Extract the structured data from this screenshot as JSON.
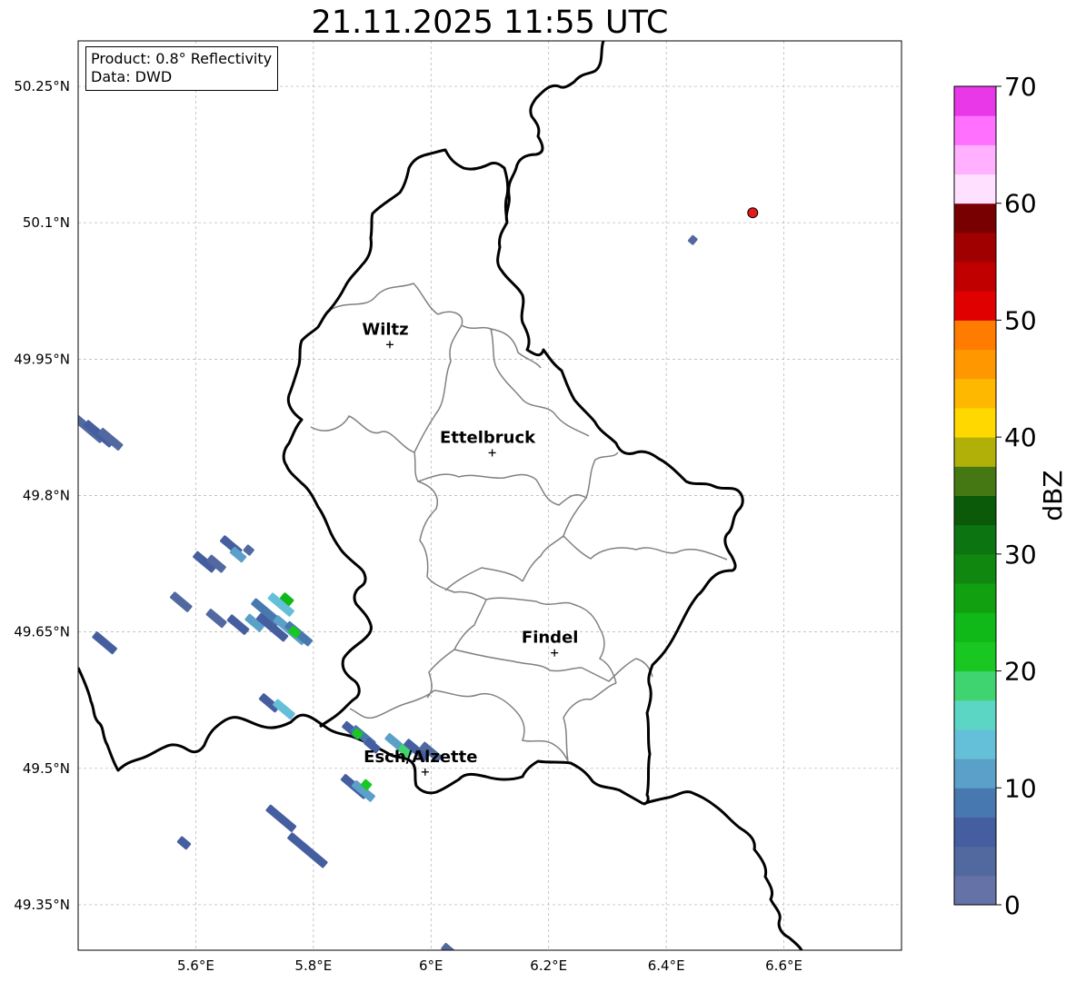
{
  "map": {
    "title": "21.11.2025 11:55 UTC",
    "info": {
      "product": "Product: 0.8° Reflectivity",
      "data": "Data: DWD"
    },
    "extent": {
      "lon": [
        5.4,
        6.8
      ],
      "lat": [
        49.3,
        50.3
      ]
    },
    "lon_ticks": [
      {
        "value": 5.6,
        "label": "5.6°E"
      },
      {
        "value": 5.8,
        "label": "5.8°E"
      },
      {
        "value": 6.0,
        "label": "6°E"
      },
      {
        "value": 6.2,
        "label": "6.2°E"
      },
      {
        "value": 6.4,
        "label": "6.4°E"
      },
      {
        "value": 6.6,
        "label": "6.6°E"
      }
    ],
    "lat_ticks": [
      {
        "value": 50.25,
        "label": "50.25°N"
      },
      {
        "value": 50.1,
        "label": "50.1°N"
      },
      {
        "value": 49.95,
        "label": "49.95°N"
      },
      {
        "value": 49.8,
        "label": "49.8°N"
      },
      {
        "value": 49.65,
        "label": "49.65°N"
      },
      {
        "value": 49.5,
        "label": "49.5°N"
      },
      {
        "value": 49.35,
        "label": "49.35°N"
      }
    ],
    "cities": [
      {
        "name": "Wiltz",
        "lon": 5.93,
        "lat": 49.966
      },
      {
        "name": "Ettelbruck",
        "lon": 6.104,
        "lat": 49.847
      },
      {
        "name": "Findel",
        "lon": 6.21,
        "lat": 49.627
      },
      {
        "name": "Esch/Alzette",
        "lon": 5.99,
        "lat": 49.496
      }
    ],
    "radar_marker": {
      "lon": 6.547,
      "lat": 50.111,
      "color": "#e31a1c"
    },
    "colorbar": {
      "label": "dBZ",
      "ticks": [
        "0",
        "10",
        "20",
        "30",
        "40",
        "50",
        "60",
        "70"
      ],
      "min": 0,
      "max": 70,
      "step": 2.5,
      "colors": [
        "#6472a8",
        "#52699f",
        "#455e9f",
        "#4878b0",
        "#5aa0c8",
        "#64c0d8",
        "#5cd6c4",
        "#40d470",
        "#18c820",
        "#10b818",
        "#10a010",
        "#108810",
        "#0c7410",
        "#0a5a0a",
        "#457812",
        "#b0b008",
        "#ffd800",
        "#ffb800",
        "#ff9800",
        "#ff7c00",
        "#e00000",
        "#c00000",
        "#a00000",
        "#780000",
        "#ffe0ff",
        "#ffb0ff",
        "#ff70ff",
        "#e838e8"
      ]
    },
    "echoes": [
      {
        "lon": 5.415,
        "lat": 49.875,
        "len": 45,
        "dbz": 3
      },
      {
        "lon": 5.435,
        "lat": 49.868,
        "len": 38,
        "dbz": 5
      },
      {
        "lon": 5.455,
        "lat": 49.862,
        "len": 30,
        "dbz": 3
      },
      {
        "lon": 5.615,
        "lat": 49.727,
        "len": 28,
        "dbz": 5
      },
      {
        "lon": 5.635,
        "lat": 49.725,
        "len": 22,
        "dbz": 4
      },
      {
        "lon": 5.66,
        "lat": 49.745,
        "len": 26,
        "dbz": 5
      },
      {
        "lon": 5.672,
        "lat": 49.735,
        "len": 18,
        "dbz": 10
      },
      {
        "lon": 5.69,
        "lat": 49.74,
        "len": 10,
        "dbz": 3
      },
      {
        "lon": 5.575,
        "lat": 49.683,
        "len": 26,
        "dbz": 4
      },
      {
        "lon": 5.635,
        "lat": 49.665,
        "len": 24,
        "dbz": 3
      },
      {
        "lon": 5.672,
        "lat": 49.658,
        "len": 26,
        "dbz": 6
      },
      {
        "lon": 5.7,
        "lat": 49.66,
        "len": 22,
        "dbz": 12
      },
      {
        "lon": 5.72,
        "lat": 49.672,
        "len": 38,
        "dbz": 8
      },
      {
        "lon": 5.745,
        "lat": 49.68,
        "len": 32,
        "dbz": 14
      },
      {
        "lon": 5.755,
        "lat": 49.686,
        "len": 14,
        "dbz": 24
      },
      {
        "lon": 5.73,
        "lat": 49.655,
        "len": 40,
        "dbz": 5
      },
      {
        "lon": 5.76,
        "lat": 49.652,
        "len": 42,
        "dbz": 11
      },
      {
        "lon": 5.775,
        "lat": 49.648,
        "len": 34,
        "dbz": 8
      },
      {
        "lon": 5.768,
        "lat": 49.65,
        "len": 12,
        "dbz": 22
      },
      {
        "lon": 5.445,
        "lat": 49.638,
        "len": 30,
        "dbz": 5
      },
      {
        "lon": 5.725,
        "lat": 49.572,
        "len": 24,
        "dbz": 6
      },
      {
        "lon": 5.75,
        "lat": 49.565,
        "len": 26,
        "dbz": 14
      },
      {
        "lon": 5.865,
        "lat": 49.542,
        "len": 22,
        "dbz": 5
      },
      {
        "lon": 5.885,
        "lat": 49.535,
        "len": 30,
        "dbz": 9
      },
      {
        "lon": 5.875,
        "lat": 49.538,
        "len": 10,
        "dbz": 20
      },
      {
        "lon": 5.9,
        "lat": 49.525,
        "len": 18,
        "dbz": 5
      },
      {
        "lon": 5.945,
        "lat": 49.525,
        "len": 34,
        "dbz": 10
      },
      {
        "lon": 5.975,
        "lat": 49.52,
        "len": 30,
        "dbz": 6
      },
      {
        "lon": 6.0,
        "lat": 49.518,
        "len": 26,
        "dbz": 4
      },
      {
        "lon": 5.955,
        "lat": 49.519,
        "len": 14,
        "dbz": 18
      },
      {
        "lon": 5.87,
        "lat": 49.48,
        "len": 34,
        "dbz": 6
      },
      {
        "lon": 5.885,
        "lat": 49.475,
        "len": 28,
        "dbz": 12
      },
      {
        "lon": 5.89,
        "lat": 49.482,
        "len": 10,
        "dbz": 20
      },
      {
        "lon": 5.745,
        "lat": 49.445,
        "len": 38,
        "dbz": 5
      },
      {
        "lon": 5.58,
        "lat": 49.418,
        "len": 14,
        "dbz": 5
      },
      {
        "lon": 5.79,
        "lat": 49.41,
        "len": 52,
        "dbz": 5
      },
      {
        "lon": 6.03,
        "lat": 49.3,
        "len": 16,
        "dbz": 3
      },
      {
        "lon": 6.445,
        "lat": 50.081,
        "len": 8,
        "dbz": 4
      }
    ]
  }
}
